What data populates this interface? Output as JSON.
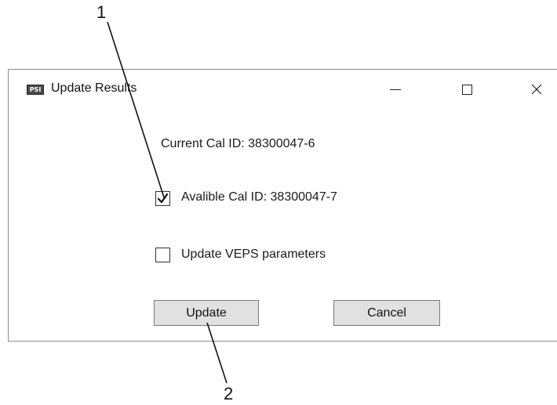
{
  "callouts": {
    "one": "1",
    "two": "2"
  },
  "window": {
    "icon_text": "PSI",
    "title": "Update Results",
    "controls": {
      "minimize": "minimize-icon",
      "maximize": "maximize-icon",
      "close": "close-icon",
      "close_glyph": "✕"
    }
  },
  "content": {
    "current_cal": "Current Cal ID: 38300047-6",
    "available_cal": {
      "label": "Avalible Cal ID: 38300047-7",
      "checked": true
    },
    "update_veps": {
      "label": "Update VEPS parameters",
      "checked": false
    }
  },
  "buttons": {
    "update": "Update",
    "cancel": "Cancel"
  }
}
